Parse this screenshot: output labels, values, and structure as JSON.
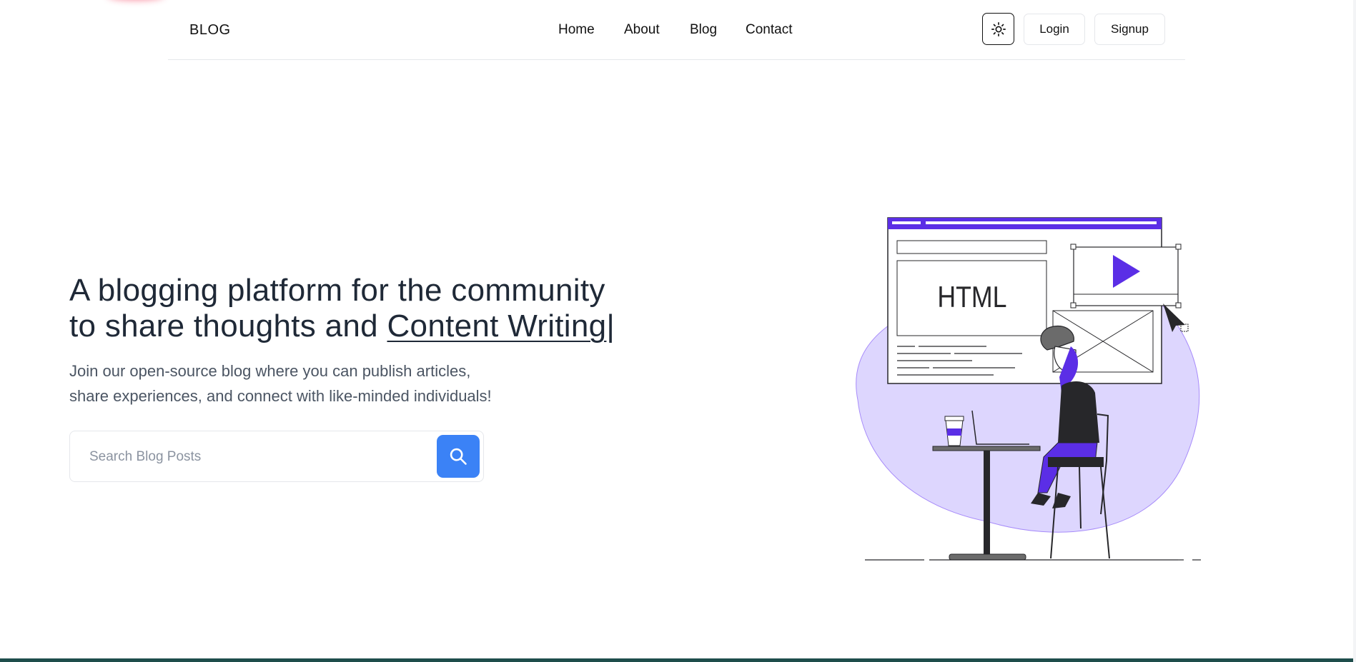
{
  "nav": {
    "brand": "BLOG",
    "links": [
      "Home",
      "About",
      "Blog",
      "Contact"
    ],
    "login": "Login",
    "signup": "Signup",
    "theme_icon": "sun-icon"
  },
  "hero": {
    "title_part1": "A blogging platform for the community",
    "title_part2": "to share thoughts and ",
    "title_typed": "Content Writing",
    "title_cursor": "|",
    "subtitle_line1": "Join our open-source blog where you can publish articles,",
    "subtitle_line2": "share experiences, and connect with like-minded individuals!"
  },
  "search": {
    "placeholder": "Search Blog Posts",
    "value": "",
    "button_icon": "search-icon"
  },
  "illustration": {
    "label": "HTML",
    "accent": "#5b2ee6",
    "blob_color": "#ddd6fe"
  },
  "colors": {
    "primary_button": "#3b82f6",
    "text_dark": "#1f2937",
    "text_muted": "#4b5563"
  }
}
